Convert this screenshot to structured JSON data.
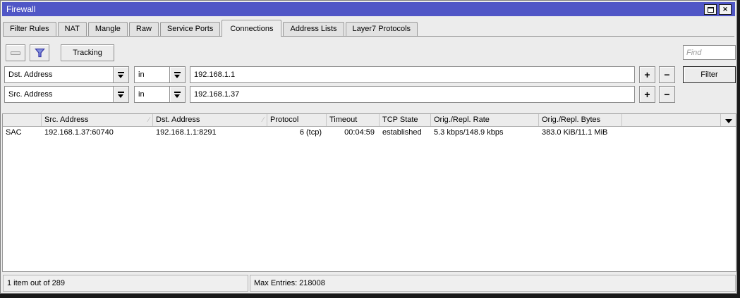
{
  "window": {
    "title": "Firewall"
  },
  "titlebar": {
    "close_glyph": "✕"
  },
  "tabs": {
    "items": [
      "Filter Rules",
      "NAT",
      "Mangle",
      "Raw",
      "Service Ports",
      "Connections",
      "Address Lists",
      "Layer7 Protocols"
    ],
    "active": "Connections"
  },
  "toolbar": {
    "tracking_label": "Tracking",
    "find_placeholder": "Find"
  },
  "filters": {
    "add_label": "+",
    "remove_label": "−",
    "filter_button_label": "Filter",
    "rows": [
      {
        "field": "Dst. Address",
        "op": "in",
        "value": "192.168.1.1"
      },
      {
        "field": "Src. Address",
        "op": "in",
        "value": "192.168.1.37"
      }
    ]
  },
  "table": {
    "columns": [
      "",
      "Src. Address",
      "Dst. Address",
      "Protocol",
      "Timeout",
      "TCP State",
      "Orig./Repl. Rate",
      "Orig./Repl. Bytes"
    ],
    "sort_marker": "∕",
    "rows": [
      {
        "flags": "SAC",
        "src_address": "192.168.1.37:60740",
        "dst_address": "192.168.1.1:8291",
        "protocol": "6 (tcp)",
        "timeout": "00:04:59",
        "tcp_state": "established",
        "orig_repl_rate": "5.3 kbps/148.9 kbps",
        "orig_repl_bytes": "383.0 KiB/11.1 MiB"
      }
    ]
  },
  "statusbar": {
    "items_text": "1 item out of 289",
    "max_entries_text": "Max Entries: 218008"
  },
  "colors": {
    "titlebar": "#5056C6",
    "window_bg": "#ECECEC",
    "funnel_fill": "#8291DD",
    "funnel_stroke": "#3B3BAA"
  }
}
